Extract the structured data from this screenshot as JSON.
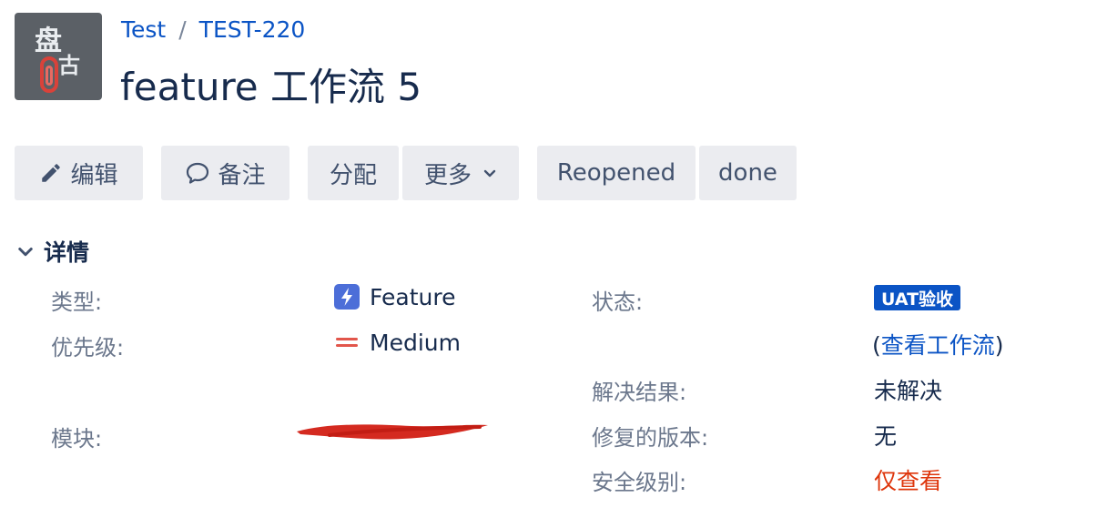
{
  "header": {
    "project": "Test",
    "separator": "/",
    "issue_key": "TEST-220",
    "title": "feature 工作流 5"
  },
  "toolbar": {
    "edit": "编辑",
    "comment": "备注",
    "assign": "分配",
    "more": "更多",
    "reopened": "Reopened",
    "done": "done"
  },
  "details": {
    "heading": "详情",
    "type_label": "类型:",
    "type_value": "Feature",
    "priority_label": "优先级:",
    "priority_value": "Medium",
    "component_label": "模块:",
    "status_label": "状态:",
    "status_value": "UAT验收",
    "workflow_open": "(",
    "workflow_link": "查看工作流",
    "workflow_close": ")",
    "resolution_label": "解决结果:",
    "resolution_value": "未解决",
    "fix_version_label": "修复的版本:",
    "fix_version_value": "无",
    "security_label": "安全级别:",
    "security_value": "仅查看"
  },
  "icons": {
    "edit": "pencil-icon",
    "comment": "speech-bubble-icon",
    "more": "chevron-down-icon",
    "section": "chevron-down-icon",
    "type": "lightning-bolt-icon",
    "priority": "priority-medium-icon"
  },
  "colors": {
    "link": "#0b54c5",
    "status_lozenge": "#0b54c5",
    "security_value": "#de350b",
    "priority_icon": "#e2564b",
    "feature_icon": "#4c6ed8"
  }
}
